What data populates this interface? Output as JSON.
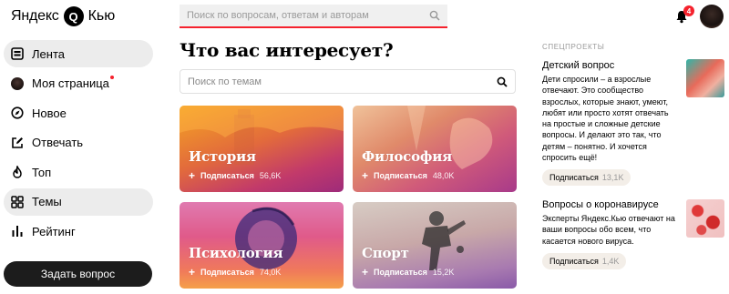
{
  "header": {
    "logo_left": "Яндекс",
    "logo_mark": "Q",
    "logo_right": "Кью",
    "search_placeholder": "Поиск по вопросам, ответам и авторам",
    "notifications_count": "4"
  },
  "sidebar": {
    "items": [
      {
        "label": "Лента",
        "icon": "feed-icon",
        "active": true
      },
      {
        "label": "Моя страница",
        "icon": "user-avatar",
        "dot": true
      },
      {
        "label": "Новое",
        "icon": "compass-icon"
      },
      {
        "label": "Отвечать",
        "icon": "edit-icon"
      },
      {
        "label": "Топ",
        "icon": "fire-icon"
      },
      {
        "label": "Темы",
        "icon": "grid-icon",
        "active": true
      },
      {
        "label": "Рейтинг",
        "icon": "rating-icon"
      }
    ],
    "ask_button": "Задать вопрос"
  },
  "main": {
    "title": "Что вас интересует?",
    "topic_search_placeholder": "Поиск по темам",
    "cards": [
      {
        "title": "История",
        "follow": "Подписаться",
        "count": "56,6K"
      },
      {
        "title": "Философия",
        "follow": "Подписаться",
        "count": "48,0K"
      },
      {
        "title": "Психология",
        "follow": "Подписаться",
        "count": "74,0K"
      },
      {
        "title": "Спорт",
        "follow": "Подписаться",
        "count": "15,2K"
      }
    ]
  },
  "specials": {
    "heading": "СПЕЦПРОЕКТЫ",
    "items": [
      {
        "title": "Детский вопрос",
        "text": "Дети спросили – а взрослые отвечают. Это сообщество взрослых, которые знают, умеют, любят или просто хотят отвечать на простые и сложные детские вопросы. И делают это так, что детям – понятно. И хочется спросить ещё!",
        "follow": "Подписаться",
        "count": "13,1K"
      },
      {
        "title": "Вопросы о коронавирусе",
        "text": "Эксперты Яндекс.Кью отвечают на ваши вопросы обо всем, что касается нового вируса.",
        "follow": "Подписаться",
        "count": "1,4K"
      }
    ]
  },
  "colors": {
    "accent_red": "#f5222d",
    "active_bg": "#ececec",
    "button_dark": "#1c1c1c",
    "follow_bg": "#f3eee8"
  }
}
